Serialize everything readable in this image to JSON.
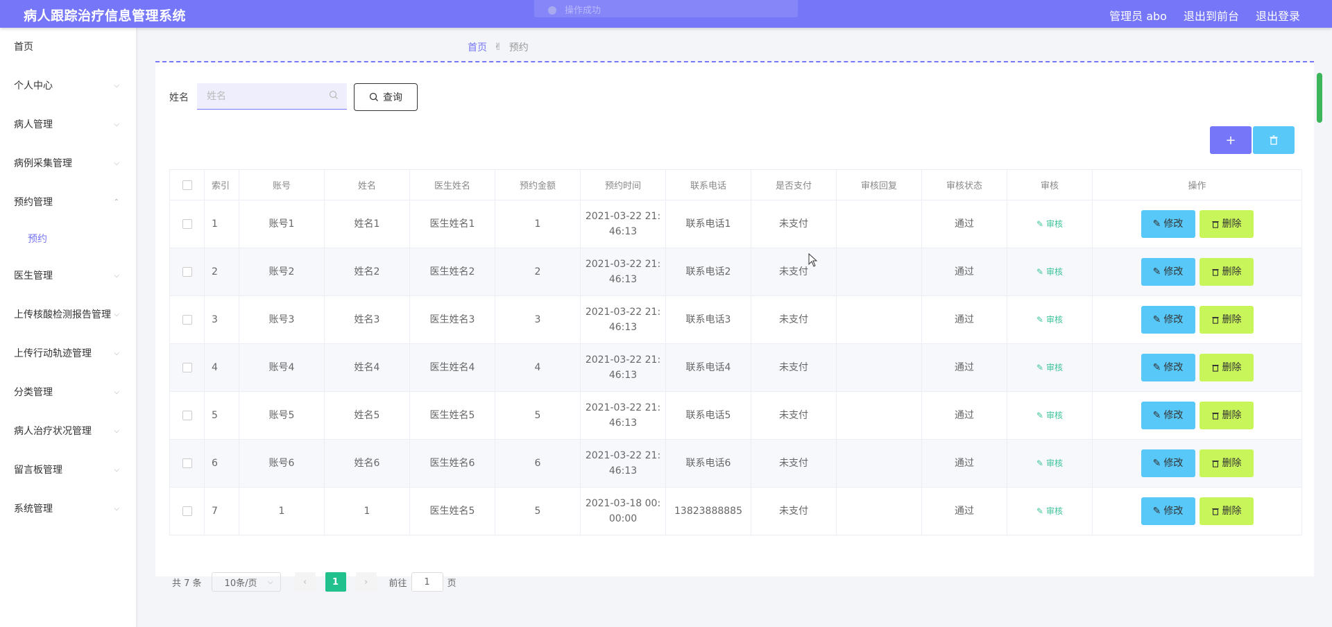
{
  "header": {
    "title": "病人跟踪治疗信息管理系统",
    "admin": "管理员 abo",
    "to_front": "退出到前台",
    "logout": "退出登录",
    "toast": "操作成功"
  },
  "sidebar": {
    "items": [
      {
        "label": "首页",
        "chevron": ""
      },
      {
        "label": "个人中心",
        "chevron": "⌵"
      },
      {
        "label": "病人管理",
        "chevron": "⌵"
      },
      {
        "label": "病例采集管理",
        "chevron": "⌵"
      },
      {
        "label": "预约管理",
        "chevron": "⌃"
      },
      {
        "label": "预约",
        "chevron": ""
      },
      {
        "label": "医生管理",
        "chevron": "⌵"
      },
      {
        "label": "上传核酸检测报告管理",
        "chevron": "⌵"
      },
      {
        "label": "上传行动轨迹管理",
        "chevron": "⌵"
      },
      {
        "label": "分类管理",
        "chevron": "⌵"
      },
      {
        "label": "病人治疗状况管理",
        "chevron": "⌵"
      },
      {
        "label": "留言板管理",
        "chevron": "⌵"
      },
      {
        "label": "系统管理",
        "chevron": "⌵"
      }
    ]
  },
  "breadcrumb": {
    "home": "首页",
    "current": "预约"
  },
  "search": {
    "label": "姓名",
    "placeholder": "姓名",
    "button": "查询"
  },
  "table": {
    "headers": [
      "索引",
      "账号",
      "姓名",
      "医生姓名",
      "预约金额",
      "预约时间",
      "联系电话",
      "是否支付",
      "审核回复",
      "审核状态",
      "审核",
      "操作"
    ],
    "rows": [
      {
        "index": "1",
        "account": "账号1",
        "name": "姓名1",
        "doctor": "医生姓名1",
        "amount": "1",
        "time1": "2021-03-22 21:",
        "time2": "46:13",
        "phone": "联系电话1",
        "paid": "未支付",
        "reply": "",
        "status": "通过"
      },
      {
        "index": "2",
        "account": "账号2",
        "name": "姓名2",
        "doctor": "医生姓名2",
        "amount": "2",
        "time1": "2021-03-22 21:",
        "time2": "46:13",
        "phone": "联系电话2",
        "paid": "未支付",
        "reply": "",
        "status": "通过"
      },
      {
        "index": "3",
        "account": "账号3",
        "name": "姓名3",
        "doctor": "医生姓名3",
        "amount": "3",
        "time1": "2021-03-22 21:",
        "time2": "46:13",
        "phone": "联系电话3",
        "paid": "未支付",
        "reply": "",
        "status": "通过"
      },
      {
        "index": "4",
        "account": "账号4",
        "name": "姓名4",
        "doctor": "医生姓名4",
        "amount": "4",
        "time1": "2021-03-22 21:",
        "time2": "46:13",
        "phone": "联系电话4",
        "paid": "未支付",
        "reply": "",
        "status": "通过"
      },
      {
        "index": "5",
        "account": "账号5",
        "name": "姓名5",
        "doctor": "医生姓名5",
        "amount": "5",
        "time1": "2021-03-22 21:",
        "time2": "46:13",
        "phone": "联系电话5",
        "paid": "未支付",
        "reply": "",
        "status": "通过"
      },
      {
        "index": "6",
        "account": "账号6",
        "name": "姓名6",
        "doctor": "医生姓名6",
        "amount": "6",
        "time1": "2021-03-22 21:",
        "time2": "46:13",
        "phone": "联系电话6",
        "paid": "未支付",
        "reply": "",
        "status": "通过"
      },
      {
        "index": "7",
        "account": "1",
        "name": "1",
        "doctor": "医生姓名5",
        "amount": "5",
        "time1": "2021-03-18 00:",
        "time2": "00:00",
        "phone": "13823888885",
        "paid": "未支付",
        "reply": "",
        "status": "通过"
      }
    ],
    "audit_label": "审核",
    "edit_label": "修改",
    "delete_label": "删除"
  },
  "pager": {
    "total": "共 7 条",
    "page_size": "10条/页",
    "current": "1",
    "goto": "前往",
    "goto_value": "1",
    "unit": "页"
  },
  "colors": {
    "accent": "#7676f8",
    "edit": "#58c8f8",
    "delete": "#c8f55a",
    "audit": "#3cc39a",
    "page_active": "#22c08c"
  }
}
